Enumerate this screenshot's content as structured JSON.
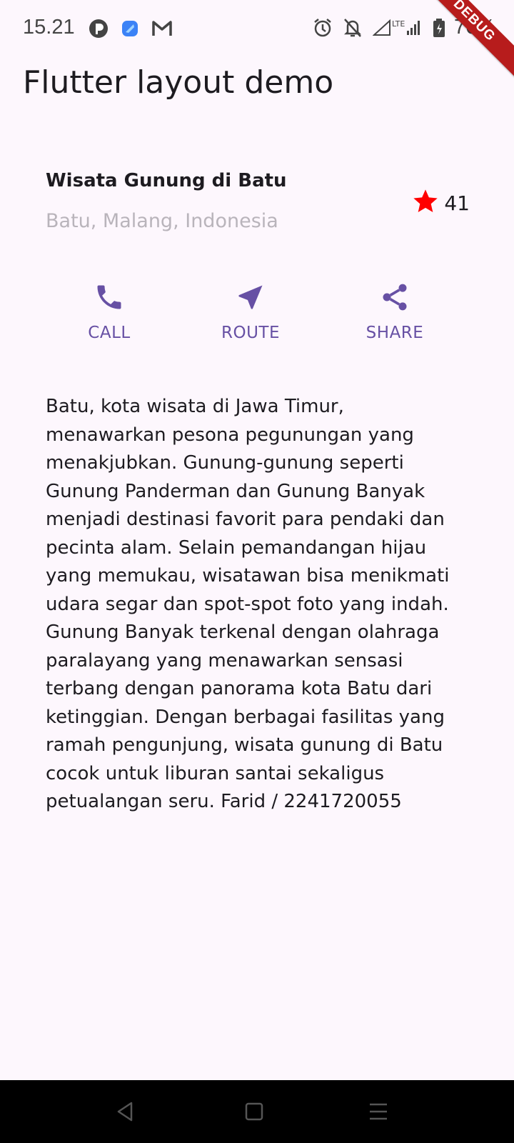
{
  "status_bar": {
    "time": "15.21",
    "battery": "76%",
    "left_icons": [
      "app-notification-icon",
      "messenger-icon",
      "gmail-icon"
    ],
    "right_icons": [
      "alarm-icon",
      "notifications-off-icon",
      "signal-lte-icon",
      "battery-icon"
    ]
  },
  "debug_banner": "DEBUG",
  "app_bar": {
    "title": "Flutter layout demo"
  },
  "place": {
    "name": "Wisata Gunung di Batu",
    "location": "Batu, Malang, Indonesia",
    "rating_count": "41"
  },
  "actions": [
    {
      "label": "CALL",
      "icon": "phone-icon"
    },
    {
      "label": "ROUTE",
      "icon": "navigation-icon"
    },
    {
      "label": "SHARE",
      "icon": "share-icon"
    }
  ],
  "description": "Batu, kota wisata di Jawa Timur, menawarkan pesona pegunungan yang menakjubkan. Gunung-gunung seperti Gunung Panderman dan Gunung Banyak menjadi destinasi favorit para pendaki dan pecinta alam. Selain pemandangan hijau yang memukau, wisatawan bisa menikmati udara segar dan spot-spot foto yang indah. Gunung Banyak terkenal dengan olahraga paralayang yang menawarkan sensasi terbang dengan panorama kota Batu dari ketinggian. Dengan berbagai fasilitas yang ramah pengunjung, wisata gunung di Batu cocok untuk liburan santai sekaligus petualangan seru. Farid / 2241720055",
  "nav_bar": [
    "back-icon",
    "home-icon",
    "recents-icon"
  ],
  "colors": {
    "accent": "#6750a4",
    "star": "#ff0000",
    "background": "#fdf7fd"
  }
}
